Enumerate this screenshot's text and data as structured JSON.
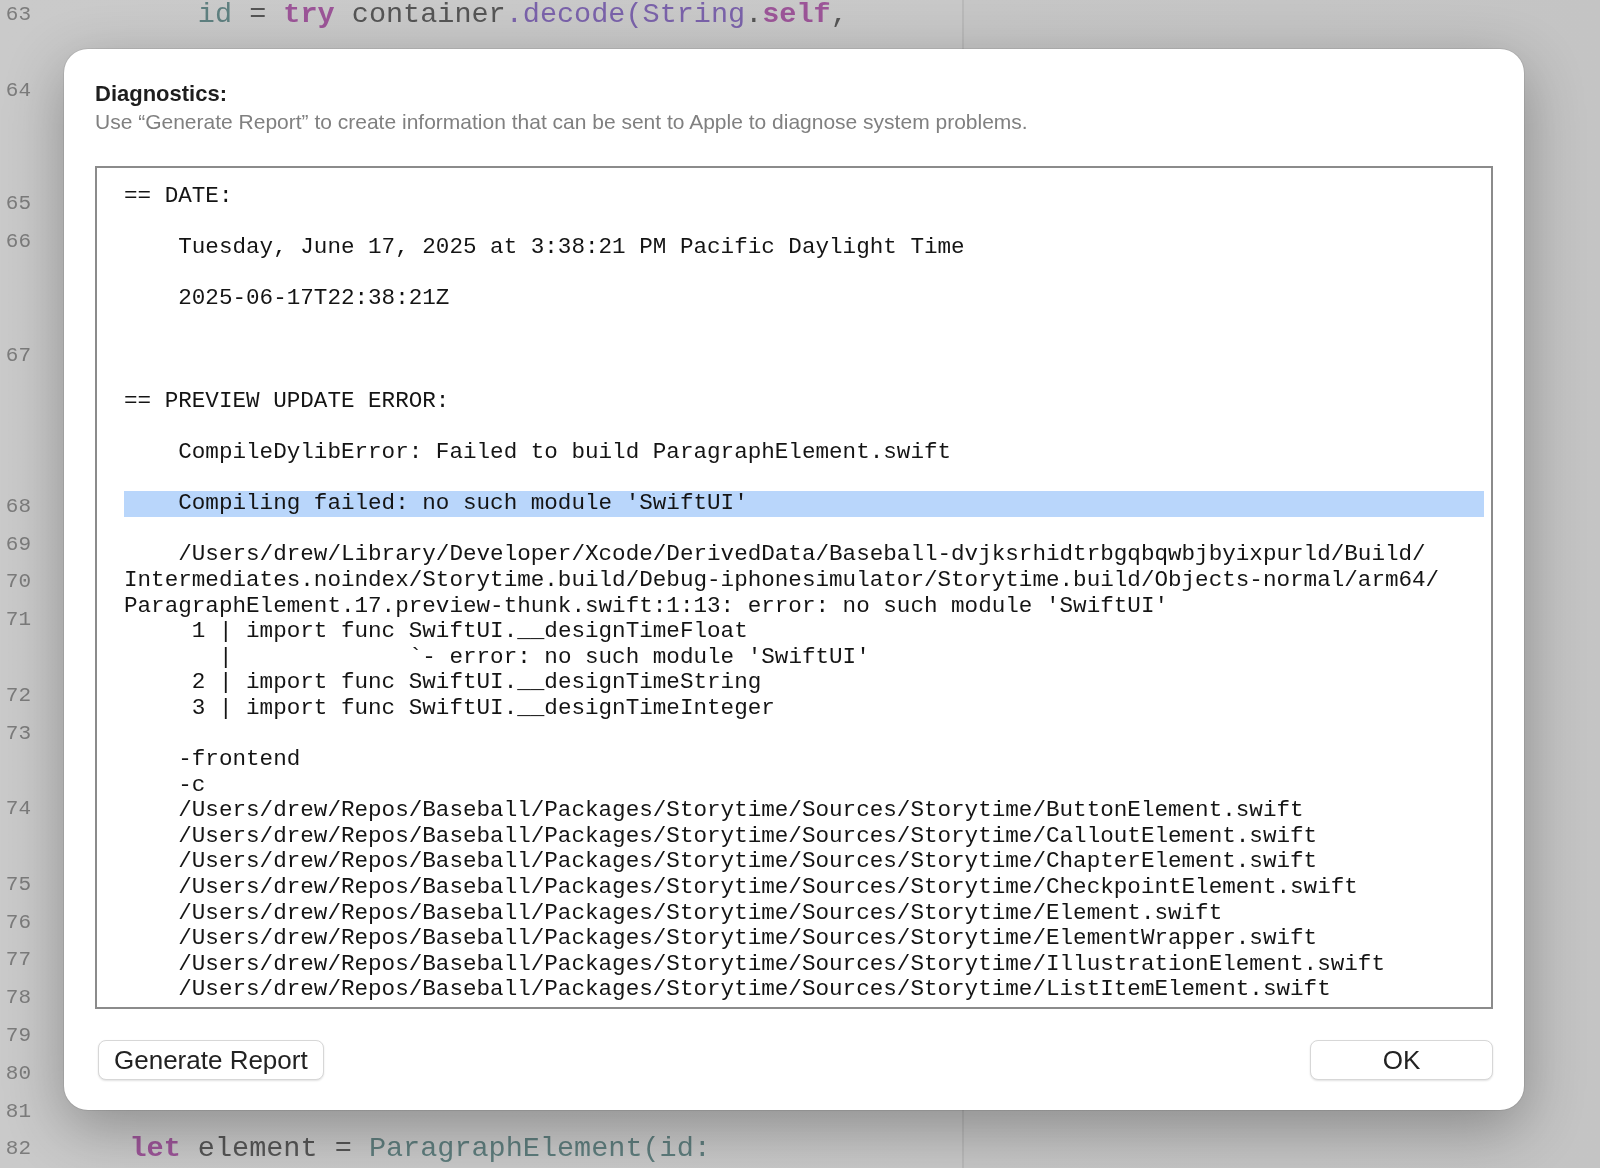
{
  "editor": {
    "rows": [
      {
        "kind": "line",
        "number": "63",
        "tokens": [
          {
            "text": "        id",
            "kind": "property"
          },
          {
            "text": " = ",
            "kind": "plain"
          },
          {
            "text": "try",
            "kind": "keyword"
          },
          {
            "text": " container",
            "kind": "plain"
          },
          {
            "text": ".decode(",
            "kind": "function"
          },
          {
            "text": "String",
            "kind": "type"
          },
          {
            "text": ".",
            "kind": "plain"
          },
          {
            "text": "self",
            "kind": "keyword"
          },
          {
            "text": ",",
            "kind": "plain"
          }
        ]
      },
      {
        "kind": "wrap"
      },
      {
        "kind": "line",
        "number": "64"
      },
      {
        "kind": "wrap"
      },
      {
        "kind": "wrap"
      },
      {
        "kind": "line",
        "number": "65"
      },
      {
        "kind": "line",
        "number": "66"
      },
      {
        "kind": "wrap"
      },
      {
        "kind": "wrap"
      },
      {
        "kind": "line",
        "number": "67"
      },
      {
        "kind": "wrap"
      },
      {
        "kind": "wrap"
      },
      {
        "kind": "wrap"
      },
      {
        "kind": "line",
        "number": "68"
      },
      {
        "kind": "line",
        "number": "69"
      },
      {
        "kind": "line",
        "number": "70"
      },
      {
        "kind": "line",
        "number": "71"
      },
      {
        "kind": "wrap"
      },
      {
        "kind": "line",
        "number": "72"
      },
      {
        "kind": "line",
        "number": "73"
      },
      {
        "kind": "wrap"
      },
      {
        "kind": "line",
        "number": "74"
      },
      {
        "kind": "wrap"
      },
      {
        "kind": "line",
        "number": "75"
      },
      {
        "kind": "line",
        "number": "76"
      },
      {
        "kind": "line",
        "number": "77"
      },
      {
        "kind": "line",
        "number": "78"
      },
      {
        "kind": "line",
        "number": "79"
      },
      {
        "kind": "line",
        "number": "80"
      },
      {
        "kind": "line",
        "number": "81"
      },
      {
        "kind": "line",
        "number": "82",
        "tokens": [
          {
            "text": "    let",
            "kind": "keyword"
          },
          {
            "text": " element = ",
            "kind": "plain"
          },
          {
            "text": "ParagraphElement(id:",
            "kind": "project"
          }
        ]
      }
    ]
  },
  "dialog": {
    "title": "Diagnostics:",
    "message": "Use “Generate Report” to create information that can be sent to Apple to diagnose system problems.",
    "log": {
      "lines": [
        {
          "kind": "text",
          "text": "== DATE:",
          "highlighted": false
        },
        {
          "kind": "blank"
        },
        {
          "kind": "text",
          "text": "    Tuesday, June 17, 2025 at 3:38:21 PM Pacific Daylight Time",
          "highlighted": false
        },
        {
          "kind": "blank"
        },
        {
          "kind": "text",
          "text": "    2025-06-17T22:38:21Z",
          "highlighted": false
        },
        {
          "kind": "blank"
        },
        {
          "kind": "blank"
        },
        {
          "kind": "blank"
        },
        {
          "kind": "text",
          "text": "== PREVIEW UPDATE ERROR:",
          "highlighted": false
        },
        {
          "kind": "blank"
        },
        {
          "kind": "text",
          "text": "    CompileDylibError: Failed to build ParagraphElement.swift",
          "highlighted": false
        },
        {
          "kind": "blank"
        },
        {
          "kind": "text",
          "text": "    Compiling failed: no such module 'SwiftUI'",
          "highlighted": true
        },
        {
          "kind": "blank"
        },
        {
          "kind": "text",
          "text": "    /Users/drew/Library/Developer/Xcode/DerivedData/Baseball-dvjksrhidtrbgqbqwbjbyixpurld/Build/",
          "highlighted": false
        },
        {
          "kind": "text",
          "text": "Intermediates.noindex/Storytime.build/Debug-iphonesimulator/Storytime.build/Objects-normal/arm64/",
          "highlighted": false
        },
        {
          "kind": "text",
          "text": "ParagraphElement.17.preview-thunk.swift:1:13: error: no such module 'SwiftUI'",
          "highlighted": false
        },
        {
          "kind": "text",
          "text": "     1 | import func SwiftUI.__designTimeFloat",
          "highlighted": false
        },
        {
          "kind": "text",
          "text": "       |             `- error: no such module 'SwiftUI'",
          "highlighted": false
        },
        {
          "kind": "text",
          "text": "     2 | import func SwiftUI.__designTimeString",
          "highlighted": false
        },
        {
          "kind": "text",
          "text": "     3 | import func SwiftUI.__designTimeInteger",
          "highlighted": false
        },
        {
          "kind": "blank"
        },
        {
          "kind": "text",
          "text": "    -frontend",
          "highlighted": false
        },
        {
          "kind": "text",
          "text": "    -c",
          "highlighted": false
        },
        {
          "kind": "text",
          "text": "    /Users/drew/Repos/Baseball/Packages/Storytime/Sources/Storytime/ButtonElement.swift",
          "highlighted": false
        },
        {
          "kind": "text",
          "text": "    /Users/drew/Repos/Baseball/Packages/Storytime/Sources/Storytime/CalloutElement.swift",
          "highlighted": false
        },
        {
          "kind": "text",
          "text": "    /Users/drew/Repos/Baseball/Packages/Storytime/Sources/Storytime/ChapterElement.swift",
          "highlighted": false
        },
        {
          "kind": "text",
          "text": "    /Users/drew/Repos/Baseball/Packages/Storytime/Sources/Storytime/CheckpointElement.swift",
          "highlighted": false
        },
        {
          "kind": "text",
          "text": "    /Users/drew/Repos/Baseball/Packages/Storytime/Sources/Storytime/Element.swift",
          "highlighted": false
        },
        {
          "kind": "text",
          "text": "    /Users/drew/Repos/Baseball/Packages/Storytime/Sources/Storytime/ElementWrapper.swift",
          "highlighted": false
        },
        {
          "kind": "text",
          "text": "    /Users/drew/Repos/Baseball/Packages/Storytime/Sources/Storytime/IllustrationElement.swift",
          "highlighted": false
        },
        {
          "kind": "text",
          "text": "    /Users/drew/Repos/Baseball/Packages/Storytime/Sources/Storytime/ListItemElement.swift",
          "highlighted": false
        }
      ]
    },
    "buttons": [
      "Generate Report",
      "OK"
    ]
  }
}
